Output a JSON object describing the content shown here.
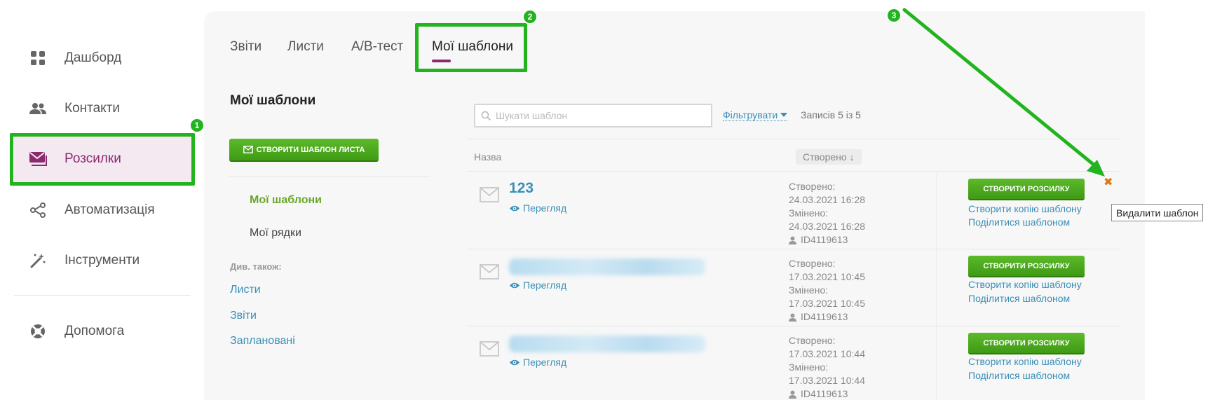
{
  "sidebar": {
    "items": [
      {
        "label": "Дашборд",
        "icon": "grid-icon"
      },
      {
        "label": "Контакти",
        "icon": "users-icon"
      },
      {
        "label": "Розсилки",
        "icon": "mail-stack-icon",
        "active": true
      },
      {
        "label": "Автоматизація",
        "icon": "share-nodes-icon"
      },
      {
        "label": "Інструменти",
        "icon": "magic-wand-icon"
      }
    ],
    "help_label": "Допомога"
  },
  "tabs": [
    {
      "label": "Звіти"
    },
    {
      "label": "Листи"
    },
    {
      "label": "A/B-тест"
    },
    {
      "label": "Мої шаблони",
      "active": true
    }
  ],
  "left": {
    "title": "Мої шаблони",
    "create_button": "СТВОРИТИ ШАБЛОН ЛИСТА",
    "link_active": "Мої шаблони",
    "link_rows": "Мої рядки",
    "see_also": "Див. також:",
    "also_links": [
      "Листи",
      "Звіти",
      "Заплановані"
    ]
  },
  "toolbar": {
    "search_placeholder": "Шукати шаблон",
    "filter_label": "Фільтрувати",
    "records_count": "Записів 5 із 5"
  },
  "table": {
    "col_name": "Назва",
    "col_created": "Створено ↓",
    "rows": [
      {
        "name": "123",
        "blurred": false,
        "preview": "Перегляд",
        "created_label": "Створено:",
        "created": "24.03.2021 16:28",
        "modified_label": "Змінено:",
        "modified": "24.03.2021 16:28",
        "owner": "ID4119613",
        "create_button": "СТВОРИТИ РОЗСИЛКУ",
        "copy_link": "Створити копію шаблону",
        "share_link": "Поділитися шаблоном"
      },
      {
        "name": "",
        "blurred": true,
        "preview": "Перегляд",
        "created_label": "Створено:",
        "created": "17.03.2021 10:45",
        "modified_label": "Змінено:",
        "modified": "17.03.2021 10:45",
        "owner": "ID4119613",
        "create_button": "СТВОРИТИ РОЗСИЛКУ",
        "copy_link": "Створити копію шаблону",
        "share_link": "Поділитися шаблоном"
      },
      {
        "name": "",
        "blurred": true,
        "preview": "Перегляд",
        "created_label": "Створено:",
        "created": "17.03.2021 10:44",
        "modified_label": "Змінено:",
        "modified": "17.03.2021 10:44",
        "owner": "ID4119613",
        "create_button": "СТВОРИТИ РОЗСИЛКУ",
        "copy_link": "Створити копію шаблону",
        "share_link": "Поділитися шаблоном"
      }
    ]
  },
  "delete": {
    "icon": "close-icon",
    "tooltip": "Видалити шаблон"
  },
  "annotations": [
    {
      "number": "1"
    },
    {
      "number": "2"
    },
    {
      "number": "3"
    }
  ],
  "colors": {
    "accent_purple": "#8a2b6e",
    "button_green": "#4aa91d",
    "link_blue": "#3a8fb7",
    "annotation_green": "#22b41f",
    "delete_orange": "#d4791e"
  }
}
